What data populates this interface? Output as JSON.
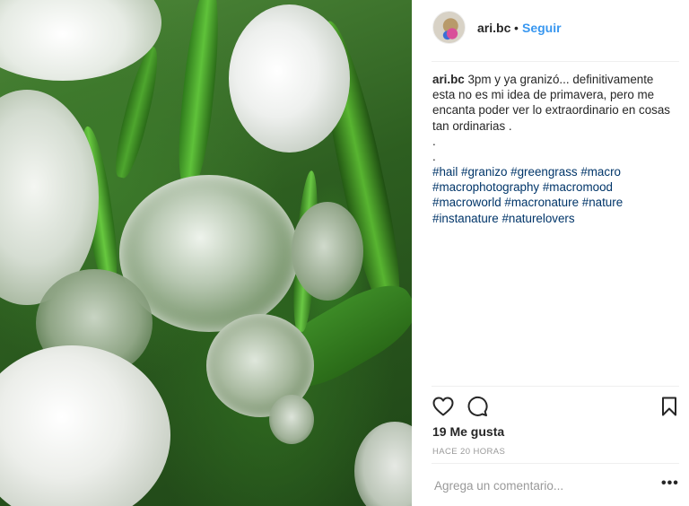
{
  "post": {
    "username": "ari.bc",
    "separator": "•",
    "follow_label": "Seguir",
    "caption": "3pm y ya granizó... definitivamente esta no es mi idea de primavera, pero me encanta poder ver lo extraordinario en cosas tan ordinarias .",
    "caption_dots": [
      ".",
      "."
    ],
    "hashtags": [
      "#hail",
      "#granizo",
      "#greengrass",
      "#macro",
      "#macrophotography",
      "#macromood",
      "#macroworld",
      "#macronature",
      "#nature",
      "#instanature",
      "#naturelovers"
    ],
    "likes_label": "19 Me gusta",
    "time_label": "HACE 20 HORAS",
    "comment_placeholder": "Agrega un comentario...",
    "more_label": "•••"
  },
  "icons": {
    "like": "heart-icon",
    "comment": "comment-bubble-icon",
    "save": "bookmark-icon",
    "more": "more-options-icon"
  },
  "colors": {
    "link": "#3897f0",
    "hashtag": "#003569",
    "text": "#262626",
    "muted": "#999999",
    "divider": "#efefef",
    "grass": "#3c7a2a"
  }
}
